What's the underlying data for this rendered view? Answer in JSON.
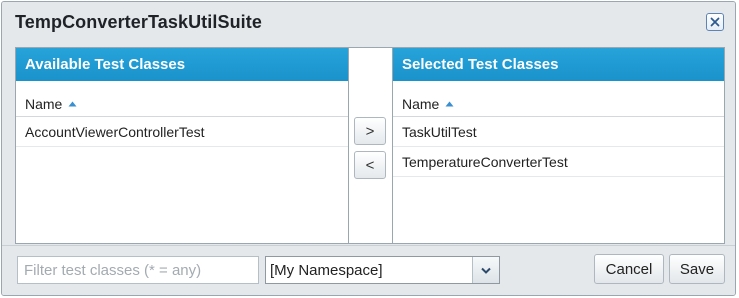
{
  "dialog": {
    "title": "TempConverterTaskUtilSuite"
  },
  "available": {
    "header": "Available Test Classes",
    "column": "Name",
    "rows": [
      "AccountViewerControllerTest"
    ]
  },
  "selected": {
    "header": "Selected Test Classes",
    "column": "Name",
    "rows": [
      "TaskUtilTest",
      "TemperatureConverterTest"
    ]
  },
  "transfer": {
    "add_label": ">",
    "remove_label": "<"
  },
  "filter": {
    "placeholder": "Filter test classes (* = any)",
    "value": ""
  },
  "namespace": {
    "selected": "[My Namespace]"
  },
  "buttons": {
    "cancel": "Cancel",
    "save": "Save"
  },
  "icons": {
    "close": "close-icon",
    "sort": "sort-ascending-icon",
    "dropdown": "chevron-down-icon"
  },
  "colors": {
    "header_blue": "#1b97d0",
    "dialog_bg": "#e4e8eb",
    "close_border": "#5d84b4"
  }
}
